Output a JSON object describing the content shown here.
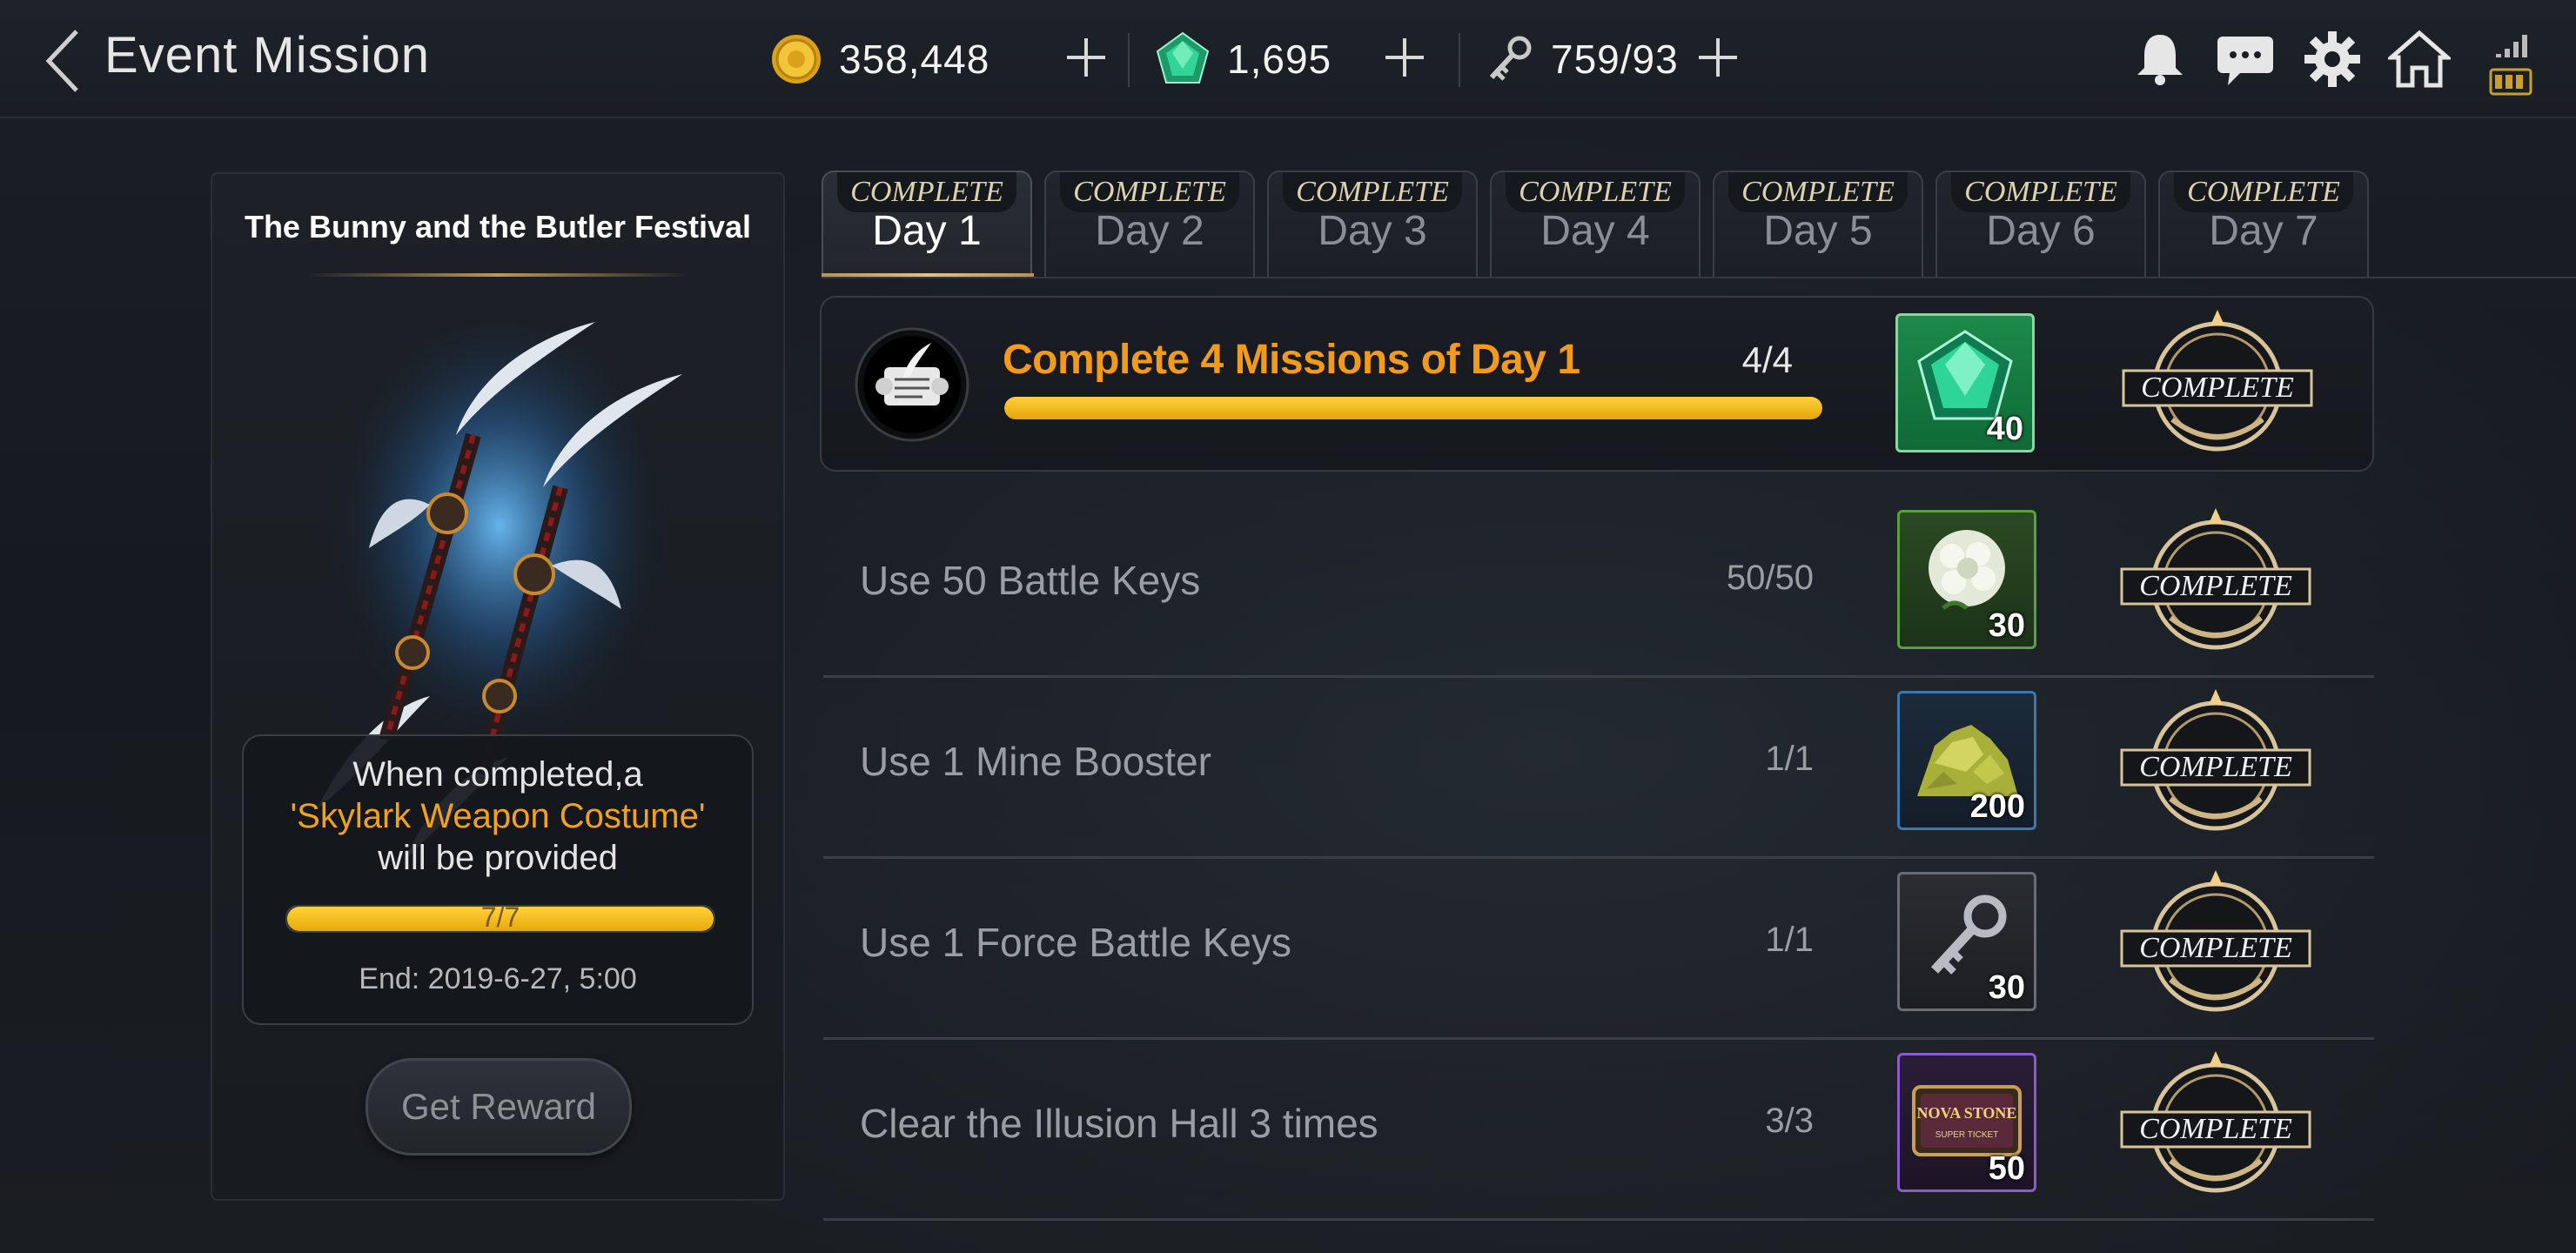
{
  "header": {
    "title": "Event Mission",
    "gold": "358,448",
    "gems": "1,695",
    "keys": "759/93"
  },
  "event": {
    "festival_title": "The Bunny and the Butler Festival",
    "info_line1": "When completed,a",
    "info_line2": "'Skylark Weapon Costume'",
    "info_line3": "will be provided",
    "progress_text": "7/7",
    "progress_fraction": 1.0,
    "end_date": "End: 2019-6-27, 5:00",
    "get_reward_label": "Get Reward"
  },
  "tabs": [
    {
      "badge": "COMPLETE",
      "label": "Day 1"
    },
    {
      "badge": "COMPLETE",
      "label": "Day 2"
    },
    {
      "badge": "COMPLETE",
      "label": "Day 3"
    },
    {
      "badge": "COMPLETE",
      "label": "Day 4"
    },
    {
      "badge": "COMPLETE",
      "label": "Day 5"
    },
    {
      "badge": "COMPLETE",
      "label": "Day 6"
    },
    {
      "badge": "COMPLETE",
      "label": "Day 7"
    }
  ],
  "active_tab": "Day 1",
  "main_mission": {
    "title": "Complete 4 Missions of Day 1",
    "count": "4/4",
    "progress_fraction": 1.0,
    "reward_qty": "40",
    "reward_icon": "gem-icon",
    "status": "COMPLETE"
  },
  "missions": [
    {
      "title": "Use 50 Battle Keys",
      "count": "50/50",
      "reward_qty": "30",
      "reward_icon": "white-flower-icon",
      "status": "COMPLETE"
    },
    {
      "title": "Use 1 Mine Booster",
      "count": "1/1",
      "reward_qty": "200",
      "reward_icon": "ore-pile-icon",
      "status": "COMPLETE"
    },
    {
      "title": "Use 1 Force Battle Keys",
      "count": "1/1",
      "reward_qty": "30",
      "reward_icon": "battle-key-icon",
      "status": "COMPLETE"
    },
    {
      "title": "Clear the Illusion Hall 3 times",
      "count": "3/3",
      "reward_qty": "50",
      "reward_icon": "nova-stone-ticket-icon",
      "status": "COMPLETE"
    }
  ],
  "nova_ticket_text": "NOVA STONE",
  "nova_ticket_subtext": "SUPER TICKET",
  "colors": {
    "accent_orange": "#f29a1c",
    "progress_yellow": "#ffd23a",
    "gem_green": "#1fbf7a"
  }
}
